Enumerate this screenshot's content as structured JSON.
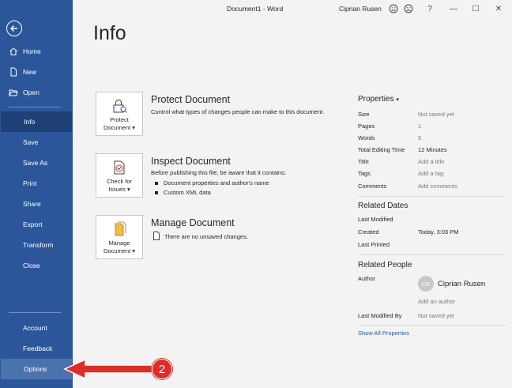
{
  "window": {
    "title": "Document1 - Word",
    "user": "Ciprian Rusen",
    "minimize_glyph": "—",
    "maximize_glyph": "☐",
    "close_glyph": "✕",
    "help_glyph": "?"
  },
  "sidebar": {
    "back_icon": "back-arrow-icon",
    "items": [
      {
        "label": "Home",
        "icon": "home-icon"
      },
      {
        "label": "New",
        "icon": "new-document-icon"
      },
      {
        "label": "Open",
        "icon": "folder-open-icon"
      },
      {
        "label": "Info"
      },
      {
        "label": "Save"
      },
      {
        "label": "Save As"
      },
      {
        "label": "Print"
      },
      {
        "label": "Share"
      },
      {
        "label": "Export"
      },
      {
        "label": "Transform"
      },
      {
        "label": "Close"
      },
      {
        "label": "Account"
      },
      {
        "label": "Feedback"
      },
      {
        "label": "Options"
      }
    ],
    "active": "Info",
    "hover": "Options"
  },
  "main": {
    "title": "Info",
    "protect": {
      "button_line1": "Protect",
      "button_line2": "Document",
      "title": "Protect Document",
      "desc": "Control what types of changes people can make to this document."
    },
    "inspect": {
      "button_line1": "Check for",
      "button_line2": "Issues",
      "title": "Inspect Document",
      "desc": "Before publishing this file, be aware that it contains:",
      "bullets": [
        "Document properties and author's name",
        "Custom XML data"
      ]
    },
    "manage": {
      "button_line1": "Manage",
      "button_line2": "Document",
      "title": "Manage Document",
      "desc": "There are no unsaved changes."
    }
  },
  "properties": {
    "heading": "Properties",
    "rows": [
      {
        "key": "Size",
        "value": "Not saved yet"
      },
      {
        "key": "Pages",
        "value": "1"
      },
      {
        "key": "Words",
        "value": "5"
      },
      {
        "key": "Total Editing Time",
        "value": "12 Minutes"
      },
      {
        "key": "Title",
        "value": "Add a title"
      },
      {
        "key": "Tags",
        "value": "Add a tag"
      },
      {
        "key": "Comments",
        "value": "Add comments"
      }
    ],
    "dates_heading": "Related Dates",
    "dates": [
      {
        "key": "Last Modified",
        "value": ""
      },
      {
        "key": "Created",
        "value": "Today, 3:03 PM"
      },
      {
        "key": "Last Printed",
        "value": ""
      }
    ],
    "people_heading": "Related People",
    "author_label": "Author",
    "author_initials": "CR",
    "author_name": "Ciprian Rusen",
    "add_author": "Add an author",
    "last_modified_by_label": "Last Modified By",
    "last_modified_by_value": "Not saved yet",
    "show_all": "Show All Properties"
  },
  "annotation": {
    "badge": "2",
    "color": "#e02b27"
  },
  "colors": {
    "sidebar": "#2b579a",
    "active": "#1e4075",
    "hover": "#4b72ad"
  }
}
